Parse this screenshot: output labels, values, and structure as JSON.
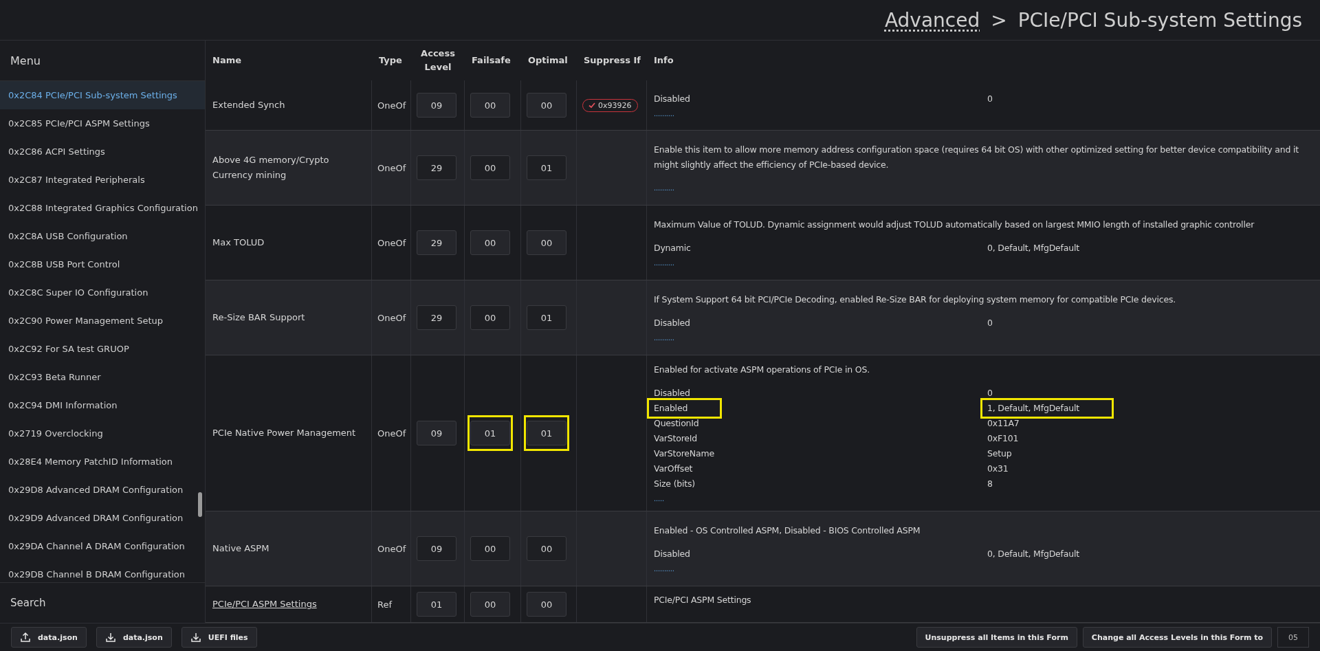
{
  "breadcrumb": {
    "parent": "Advanced",
    "separator": ">",
    "current": "PCIe/PCI Sub-system Settings"
  },
  "sidebar": {
    "title": "Menu",
    "items": [
      {
        "label": "0x2C84 PCIe/PCI Sub-system Settings",
        "selected": true
      },
      {
        "label": "0x2C85 PCIe/PCI ASPM Settings",
        "selected": false
      },
      {
        "label": "0x2C86 ACPI Settings",
        "selected": false
      },
      {
        "label": "0x2C87 Integrated Peripherals",
        "selected": false
      },
      {
        "label": "0x2C88 Integrated Graphics Configuration",
        "selected": false
      },
      {
        "label": "0x2C8A USB Configuration",
        "selected": false
      },
      {
        "label": "0x2C8B USB Port Control",
        "selected": false
      },
      {
        "label": "0x2C8C Super IO Configuration",
        "selected": false
      },
      {
        "label": "0x2C90 Power Management Setup",
        "selected": false
      },
      {
        "label": "0x2C92 For SA test GRUOP",
        "selected": false
      },
      {
        "label": "0x2C93 Beta Runner",
        "selected": false
      },
      {
        "label": "0x2C94 DMI Information",
        "selected": false
      },
      {
        "label": "0x2719 Overclocking",
        "selected": false
      },
      {
        "label": "0x28E4 Memory PatchID Information",
        "selected": false
      },
      {
        "label": "0x29D8 Advanced DRAM Configuration",
        "selected": false
      },
      {
        "label": "0x29D9 Advanced DRAM Configuration",
        "selected": false
      },
      {
        "label": "0x29DA Channel A DRAM Configuration",
        "selected": false
      },
      {
        "label": "0x29DB Channel B DRAM Configuration",
        "selected": false
      }
    ],
    "search": "Search"
  },
  "table": {
    "columns": [
      "Name",
      "Type",
      "Access Level",
      "Failsafe",
      "Optimal",
      "Suppress If",
      "Info"
    ],
    "rows": [
      {
        "kind": "setting",
        "name": "Extended Synch",
        "type": "OneOf",
        "access": "09",
        "failsafe": {
          "value": "00",
          "highlighted": false
        },
        "optimal": {
          "value": "00",
          "highlighted": false
        },
        "suppress": "0x93926",
        "options": [
          {
            "name": "Disabled",
            "value": "0",
            "highlighted": false
          }
        ],
        "more": ".........."
      },
      {
        "kind": "setting",
        "name": "Above 4G memory/Crypto Currency mining",
        "type": "OneOf",
        "access": "29",
        "failsafe": {
          "value": "00",
          "highlighted": false
        },
        "optimal": {
          "value": "01",
          "highlighted": false
        },
        "description": "Enable this item to allow more memory address configuration space (requires 64 bit OS) with other optimized setting for better device compatibility and it might slightly affect the efficiency of PCIe-based device.",
        "options": [],
        "more": ".........."
      },
      {
        "kind": "setting",
        "name": "Max TOLUD",
        "type": "OneOf",
        "access": "29",
        "failsafe": {
          "value": "00",
          "highlighted": false
        },
        "optimal": {
          "value": "00",
          "highlighted": false
        },
        "description": "Maximum Value of TOLUD. Dynamic assignment would adjust TOLUD automatically based on largest MMIO length of installed graphic controller",
        "options": [
          {
            "name": "Dynamic",
            "value": "0, Default, MfgDefault",
            "highlighted": false
          }
        ],
        "more": ".........."
      },
      {
        "kind": "setting",
        "name": "Re-Size BAR Support",
        "type": "OneOf",
        "access": "29",
        "failsafe": {
          "value": "00",
          "highlighted": false
        },
        "optimal": {
          "value": "01",
          "highlighted": false
        },
        "description": "If System Support 64 bit PCI/PCIe Decoding, enabled Re-Size BAR for deploying system memory for compatible PCIe devices.",
        "options": [
          {
            "name": "Disabled",
            "value": "0",
            "highlighted": false
          }
        ],
        "more": ".........."
      },
      {
        "kind": "setting",
        "name": "PCIe Native Power Management",
        "type": "OneOf",
        "access": "09",
        "failsafe": {
          "value": "01",
          "highlighted": true
        },
        "optimal": {
          "value": "01",
          "highlighted": true
        },
        "description": "Enabled for activate ASPM operations of PCIe in OS.",
        "options": [
          {
            "name": "Disabled",
            "value": "0",
            "highlighted": false
          },
          {
            "name": "Enabled",
            "value": "1, Default, MfgDefault",
            "highlighted": true
          },
          {
            "name": "QuestionId",
            "value": "0x11A7",
            "highlighted": false
          },
          {
            "name": "VarStoreId",
            "value": "0xF101",
            "highlighted": false
          },
          {
            "name": "VarStoreName",
            "value": "Setup",
            "highlighted": false
          },
          {
            "name": "VarOffset",
            "value": "0x31",
            "highlighted": false
          },
          {
            "name": "Size (bits)",
            "value": "8",
            "highlighted": false
          }
        ],
        "more": "....."
      },
      {
        "kind": "setting",
        "name": "Native ASPM",
        "type": "OneOf",
        "access": "09",
        "failsafe": {
          "value": "00",
          "highlighted": false
        },
        "optimal": {
          "value": "00",
          "highlighted": false
        },
        "description": "Enabled - OS Controlled ASPM, Disabled - BIOS Controlled ASPM",
        "options": [
          {
            "name": "Disabled",
            "value": "0, Default, MfgDefault",
            "highlighted": false
          }
        ],
        "more": ".........."
      },
      {
        "kind": "ref",
        "name": "PCIe/PCI ASPM Settings",
        "type": "Ref",
        "access": "01",
        "failsafe": {
          "value": "00",
          "highlighted": false
        },
        "optimal": {
          "value": "00",
          "highlighted": false
        },
        "description": "PCIe/PCI ASPM Settings",
        "options": []
      }
    ]
  },
  "footer": {
    "left": [
      {
        "kind": "upload",
        "label": "data.json"
      },
      {
        "kind": "download",
        "label": "data.json"
      },
      {
        "kind": "download",
        "label": "UEFI files"
      }
    ],
    "unsuppress": "Unsuppress all Items in this Form",
    "change": "Change all Access Levels in this Form to",
    "level": "05"
  }
}
